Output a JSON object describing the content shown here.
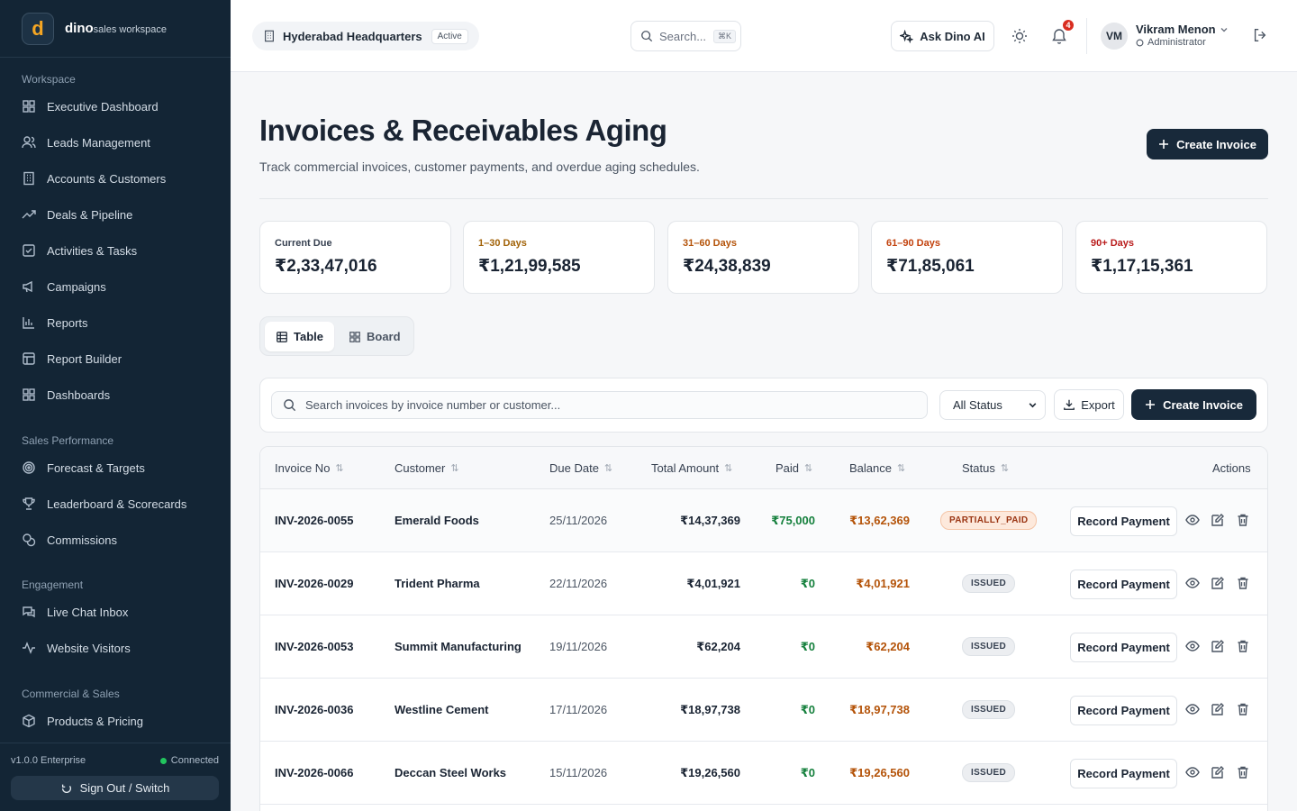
{
  "brand": {
    "letter": "d",
    "name": "dino",
    "sub": "sales workspace"
  },
  "sidebar": {
    "sections": [
      {
        "title": "Workspace",
        "items": [
          {
            "label": "Executive Dashboard",
            "icon": "grid-icon"
          },
          {
            "label": "Leads Management",
            "icon": "users-icon"
          },
          {
            "label": "Accounts & Customers",
            "icon": "building-icon"
          },
          {
            "label": "Deals & Pipeline",
            "icon": "trend-icon"
          },
          {
            "label": "Activities & Tasks",
            "icon": "checkbox-icon"
          },
          {
            "label": "Campaigns",
            "icon": "megaphone-icon"
          },
          {
            "label": "Reports",
            "icon": "bar-chart-icon"
          },
          {
            "label": "Report Builder",
            "icon": "layout-icon"
          },
          {
            "label": "Dashboards",
            "icon": "grid-icon"
          }
        ]
      },
      {
        "title": "Sales Performance",
        "items": [
          {
            "label": "Forecast & Targets",
            "icon": "target-icon"
          },
          {
            "label": "Leaderboard & Scorecards",
            "icon": "trophy-icon"
          },
          {
            "label": "Commissions",
            "icon": "coins-icon"
          }
        ]
      },
      {
        "title": "Engagement",
        "items": [
          {
            "label": "Live Chat Inbox",
            "icon": "chat-icon"
          },
          {
            "label": "Website Visitors",
            "icon": "activity-icon"
          }
        ]
      },
      {
        "title": "Commercial & Sales",
        "items": [
          {
            "label": "Products & Pricing",
            "icon": "package-icon"
          }
        ]
      }
    ],
    "footer": {
      "version": "v1.0.0 Enterprise",
      "status": "Connected",
      "signout": "Sign Out / Switch"
    }
  },
  "header": {
    "workspace": "Hyderabad Headquarters",
    "workspace_badge": "Active",
    "search_placeholder": "Search...",
    "search_kbd": "⌘K",
    "ask_ai": "Ask Dino AI",
    "notifications": "4",
    "user": {
      "initials": "VM",
      "name": "Vikram Menon",
      "role": "Administrator"
    }
  },
  "page": {
    "title": "Invoices & Receivables Aging",
    "subtitle": "Track commercial invoices, customer payments, and overdue aging schedules.",
    "create_label": "Create Invoice"
  },
  "stats": [
    {
      "label": "Current Due",
      "value": "₹2,33,47,016",
      "color": "#374151"
    },
    {
      "label": "1–30 Days",
      "value": "₹1,21,99,585",
      "color": "#a16207"
    },
    {
      "label": "31–60 Days",
      "value": "₹24,38,839",
      "color": "#b45309"
    },
    {
      "label": "61–90 Days",
      "value": "₹71,85,061",
      "color": "#c2410c"
    },
    {
      "label": "90+ Days",
      "value": "₹1,17,15,361",
      "color": "#b91c1c"
    }
  ],
  "views": {
    "table": "Table",
    "board": "Board"
  },
  "toolbar": {
    "search_placeholder": "Search invoices by invoice number or customer...",
    "status_filter": "All Status",
    "export": "Export",
    "create": "Create Invoice"
  },
  "table": {
    "columns": [
      "Invoice No",
      "Customer",
      "Due Date",
      "Total Amount",
      "Paid",
      "Balance",
      "Status",
      "Actions"
    ],
    "rows": [
      {
        "invoice": "INV-2026-0055",
        "customer": "Emerald Foods",
        "due": "25/11/2026",
        "total": "₹14,37,369",
        "paid": "₹75,000",
        "balance": "₹13,62,369",
        "status": "PARTIALLY_PAID",
        "action": "Record Payment"
      },
      {
        "invoice": "INV-2026-0029",
        "customer": "Trident Pharma",
        "due": "22/11/2026",
        "total": "₹4,01,921",
        "paid": "₹0",
        "balance": "₹4,01,921",
        "status": "ISSUED",
        "action": "Record Payment"
      },
      {
        "invoice": "INV-2026-0053",
        "customer": "Summit Manufacturing",
        "due": "19/11/2026",
        "total": "₹62,204",
        "paid": "₹0",
        "balance": "₹62,204",
        "status": "ISSUED",
        "action": "Record Payment"
      },
      {
        "invoice": "INV-2026-0036",
        "customer": "Westline Cement",
        "due": "17/11/2026",
        "total": "₹18,97,738",
        "paid": "₹0",
        "balance": "₹18,97,738",
        "status": "ISSUED",
        "action": "Record Payment"
      },
      {
        "invoice": "INV-2026-0066",
        "customer": "Deccan Steel Works",
        "due": "15/11/2026",
        "total": "₹19,26,560",
        "paid": "₹0",
        "balance": "₹19,26,560",
        "status": "ISSUED",
        "action": "Record Payment"
      }
    ]
  }
}
